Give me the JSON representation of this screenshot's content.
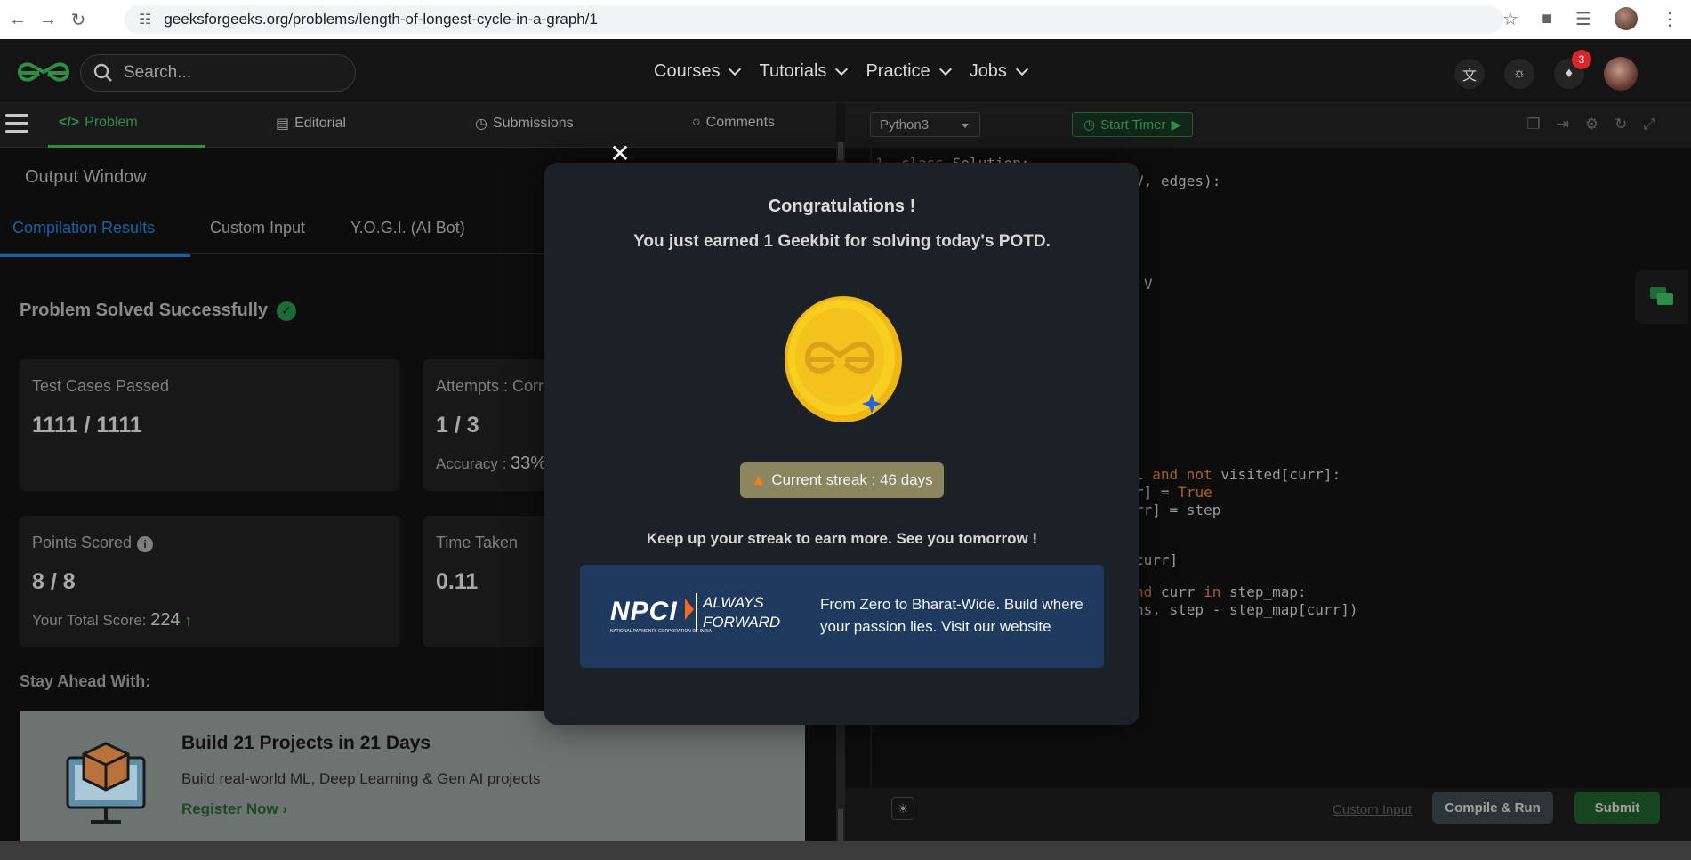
{
  "browser": {
    "url": "geeksforgeeks.org/problems/length-of-longest-cycle-in-a-graph/1"
  },
  "header": {
    "search_placeholder": "Search...",
    "nav": [
      {
        "label": "Courses"
      },
      {
        "label": "Tutorials"
      },
      {
        "label": "Practice"
      },
      {
        "label": "Jobs"
      }
    ],
    "notification_count": "3"
  },
  "problem_tabs": [
    {
      "label": "Problem",
      "icon": "code-icon"
    },
    {
      "label": "Editorial",
      "icon": "document-icon"
    },
    {
      "label": "Submissions",
      "icon": "clock-icon"
    },
    {
      "label": "Comments",
      "icon": "comment-icon"
    }
  ],
  "output": {
    "title": "Output Window",
    "tabs": [
      {
        "label": "Compilation Results"
      },
      {
        "label": "Custom Input"
      },
      {
        "label": "Y.O.G.I. (AI Bot)"
      }
    ],
    "status": "Problem Solved Successfully",
    "cards": {
      "test_cases": {
        "label": "Test Cases Passed",
        "value": "1111 / 1111"
      },
      "attempts": {
        "label": "Attempts : Corr",
        "value": "1 / 3",
        "sub_label": "Accuracy :",
        "sub_value": "33%"
      },
      "points": {
        "label": "Points Scored",
        "value": "8 / 8",
        "sub_label": "Your Total Score:",
        "sub_value": "224"
      },
      "time": {
        "label": "Time Taken",
        "value": "0.11"
      }
    },
    "stay_ahead": "Stay Ahead With:",
    "promo": {
      "title": "Build 21 Projects in 21 Days",
      "desc": "Build real-world ML, Deep Learning & Gen AI projects",
      "link": "Register Now ›"
    }
  },
  "editor": {
    "language": "Python3",
    "timer_label": "Start Timer",
    "code": {
      "line1_num": "1",
      "line1_kw": "class",
      "line1_rest": " Solution:",
      "line2": "V, edges):",
      "line3": "V",
      "line4a": "l ",
      "line4b": "and not",
      "line4c": " visited[curr]:",
      "line5a": "r] = ",
      "line5b": "True",
      "line6": "rr] = step",
      "line7": "curr]",
      "line8a": "nd",
      "line8b": " curr ",
      "line8c": "in",
      "line8d": " step_map:",
      "line9": "ns, step - step_map[curr])"
    },
    "custom_input": "Custom Input",
    "compile_run": "Compile & Run",
    "submit": "Submit"
  },
  "modal": {
    "title": "Congratulations !",
    "subtitle": "You just earned 1 Geekbit for solving today's POTD.",
    "streak": "Current streak : 46 days",
    "keep": "Keep up your streak to earn more. See you tomorrow !",
    "ad": {
      "logo_text": "NPCI",
      "logo_tag1": "ALWAYS",
      "logo_tag2": "FORWARD",
      "logo_small": "NATIONAL PAYMENTS CORPORATION OF INDIA",
      "text": "From Zero to Bharat-Wide. Build where your passion lies. Visit our website"
    }
  },
  "colors": {
    "gfg_green": "#2f8d46",
    "link_blue": "#1c5fa0",
    "modal_bg": "#1b2126",
    "ad_bg": "#1e3a5f",
    "streak_bg": "#8a8660"
  }
}
